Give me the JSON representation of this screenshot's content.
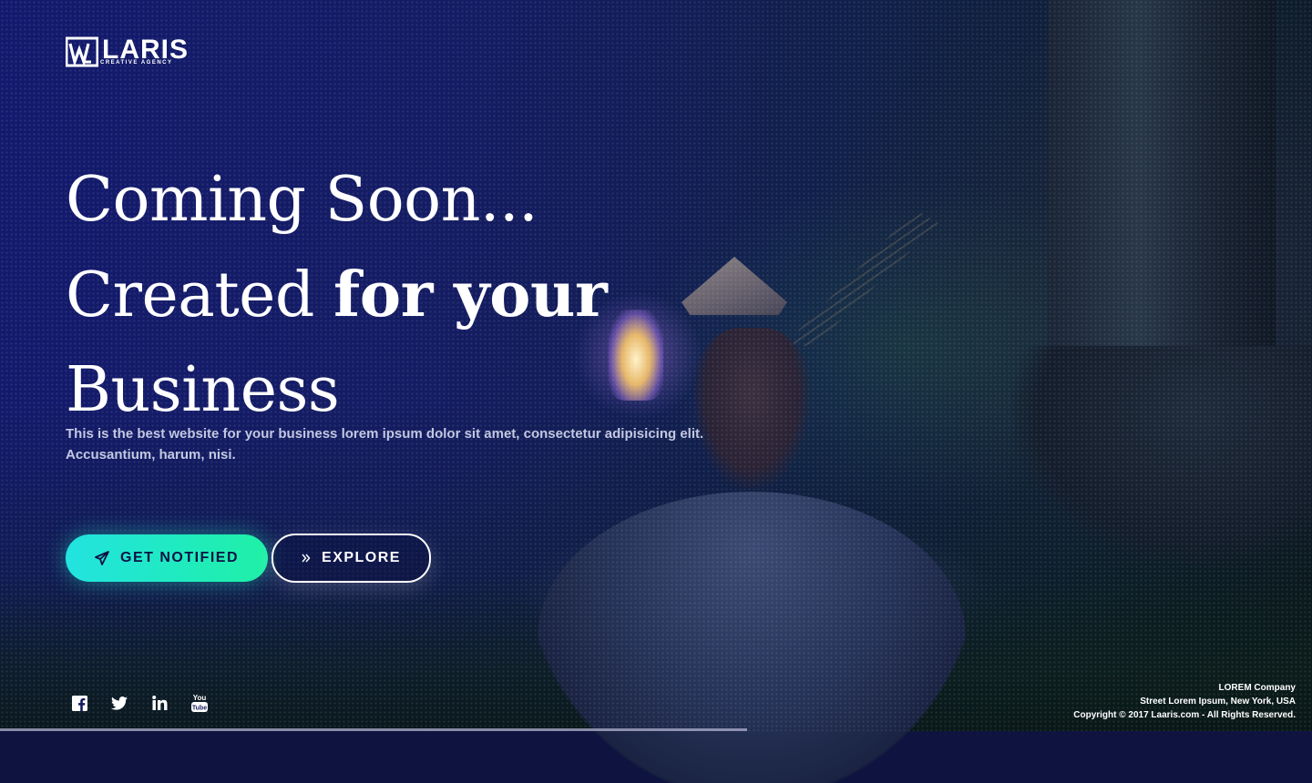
{
  "brand": {
    "name": "LARIS",
    "tagline": "CREATIVE AGENCY",
    "logo_icon": "wm-monogram-icon"
  },
  "hero": {
    "headline": {
      "line1": "Coming Soon...",
      "line2_plain": "Created ",
      "line2_highlight": "for your",
      "line3": "Business"
    },
    "subtitle_line1": "This is the best website for your business lorem ipsum dolor sit amet, consectetur adipisicing elit.",
    "subtitle_line2": "Accusantium, harum, nisi.",
    "highlight_colors": [
      "#1de1c8",
      "#1fe99a"
    ]
  },
  "buttons": {
    "notify": {
      "label": "GET NOTIFIED",
      "icon": "paper-plane-icon"
    },
    "explore": {
      "label": "EXPLORE",
      "icon": "double-chevron-right-icon"
    }
  },
  "social": [
    {
      "icon": "facebook-icon"
    },
    {
      "icon": "twitter-icon"
    },
    {
      "icon": "linkedin-icon"
    },
    {
      "icon": "youtube-icon",
      "label_top": "You",
      "label_bottom": "Tube"
    }
  ],
  "footer": {
    "company": "LOREM Company",
    "address": "Street Lorem Ipsum, New York, USA",
    "copyright": "Copyright © 2017 Laaris.com - All Rights Reserved."
  },
  "colors": {
    "background": "#131a6e",
    "accent_start": "#22e3e0",
    "accent_end": "#1ff0a6",
    "text_muted": "#c3c8e2"
  }
}
